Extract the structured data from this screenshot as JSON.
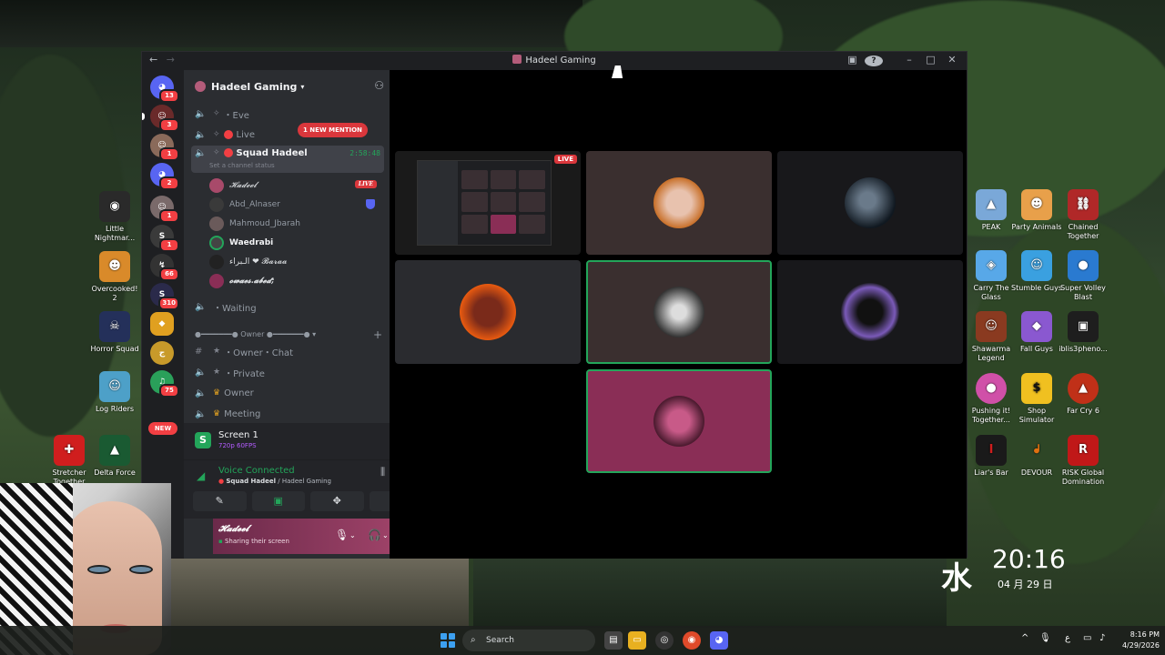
{
  "window": {
    "title": "Hadeel Gaming",
    "nav_back": "←",
    "nav_forward": "→",
    "help": "?",
    "minimize": "–",
    "maximize": "□",
    "close": "✕"
  },
  "guilds": {
    "badges": [
      "13",
      "3",
      "1",
      "2",
      "1",
      "1",
      "66",
      "310",
      "75"
    ],
    "new_label": "NEW"
  },
  "server": {
    "name": "Hadeel Gaming",
    "mention_pill": "1 NEW MENTION"
  },
  "channels": {
    "items": [
      {
        "label": "・Eve"
      },
      {
        "label": "Live"
      },
      {
        "label": "Squad Hadeel",
        "timer": "2:58:48",
        "status": "Set a channel status"
      }
    ],
    "voice_users": [
      {
        "name": "𝓗𝓪𝓭𝓮𝓮𝓵",
        "badge": "LIVE"
      },
      {
        "name": "Abd_Alnaser"
      },
      {
        "name": "Mahmoud_Jbarah"
      },
      {
        "name": "Waedrabi"
      },
      {
        "name": "الـبراء ❤ 𝓑𝓪𝓻𝓪𝓪"
      },
      {
        "name": "𝓸𝔀𝓪𝓮𝓼.𝓪𝓫𝓮𝓭;"
      }
    ],
    "waiting": "・Waiting",
    "category": "Owner",
    "channels_after": [
      {
        "label": "・Owner・Chat"
      },
      {
        "label": "・Private"
      },
      {
        "label": "Owner"
      },
      {
        "label": "Meeting"
      }
    ]
  },
  "stream_panel": {
    "title": "Screen 1",
    "sub": "720p 60FPS"
  },
  "voice_panel": {
    "title": "Voice Connected",
    "channel": "Squad Hadeel",
    "server": "Hadeel Gaming"
  },
  "user_panel": {
    "name": "𝓗𝓪𝓭𝓮𝓮𝓵",
    "status": "Sharing their screen"
  },
  "stage": {
    "live_label": "LIVE"
  },
  "desktop_icons": [
    {
      "label": "Little Nightmar...",
      "color": "#2a2a2a"
    },
    {
      "label": "Overcooked! 2",
      "color": "#d98a2a"
    },
    {
      "label": "Horror Squad",
      "color": "#24305a"
    },
    {
      "label": "Log Riders",
      "color": "#4da0c8"
    },
    {
      "label": "Stretcher Together",
      "color": "#d01e1e"
    },
    {
      "label": "Delta Force",
      "color": "#1a5a32"
    },
    {
      "label": "PEAK",
      "color": "#7aa8d8"
    },
    {
      "label": "Party Animals",
      "color": "#e8a04a"
    },
    {
      "label": "Chained Together",
      "color": "#b02828"
    },
    {
      "label": "Carry The Glass",
      "color": "#58a8e8"
    },
    {
      "label": "Stumble Guys",
      "color": "#3aa0e0"
    },
    {
      "label": "Super Volley Blast",
      "color": "#2a7ad0"
    },
    {
      "label": "Shawarma Legend",
      "color": "#8a3a20"
    },
    {
      "label": "Fall Guys",
      "color": "#8a58d0"
    },
    {
      "label": "iblis3pheno...",
      "color": "#1e1e1e"
    },
    {
      "label": "Pushing it! Together...",
      "color": "#d050a8"
    },
    {
      "label": "Shop Simulator",
      "color": "#f0c020"
    },
    {
      "label": "Far Cry 6",
      "color": "#c03018"
    },
    {
      "label": "Liar's Bar",
      "color": "#1a1a1a"
    },
    {
      "label": "DEVOUR",
      "color": "#e07010"
    },
    {
      "label": "RISK Global Domination",
      "color": "#c01818"
    }
  ],
  "desktop_clock": {
    "logo": "水",
    "time": "20:16",
    "date": "04 月 29 日"
  },
  "taskbar": {
    "search_placeholder": "Search",
    "clock_time": "8:16 PM",
    "clock_date": "4/29/2026"
  }
}
